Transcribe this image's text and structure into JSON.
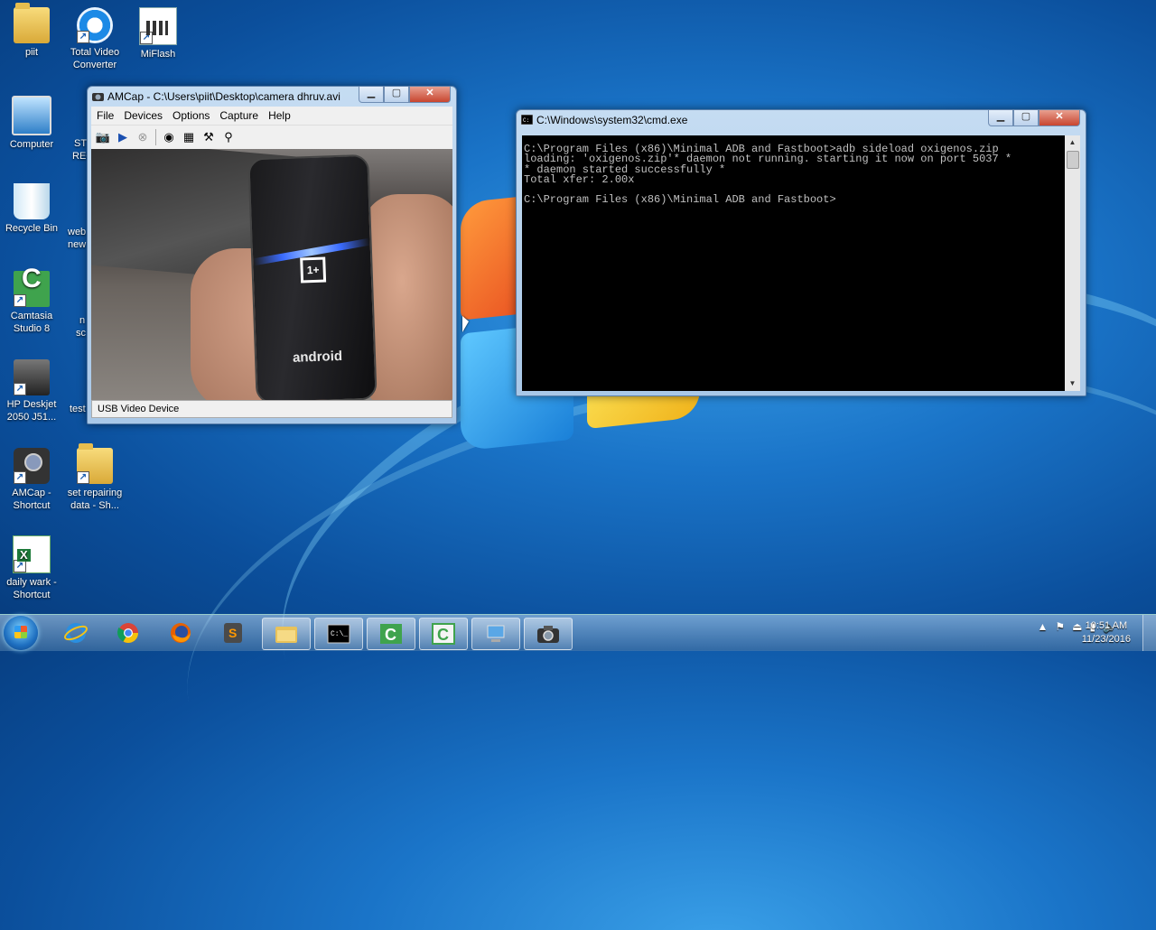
{
  "desktop": {
    "icons": [
      {
        "label": "piit"
      },
      {
        "label": "Total Video Converter"
      },
      {
        "label": "MiFlash"
      },
      {
        "label": "Computer"
      },
      {
        "label": "Recycle Bin"
      },
      {
        "label": "Camtasia Studio 8"
      },
      {
        "label": "HP Deskjet 2050 J51..."
      },
      {
        "label": "AMCap - Shortcut"
      },
      {
        "label": "set repairing data - Sh..."
      },
      {
        "label": "daily wark - Shortcut"
      }
    ],
    "partial_labels": [
      "ST",
      "REC",
      "web",
      "new",
      "n",
      "sc",
      "test"
    ]
  },
  "amcap": {
    "title": "AMCap - C:\\Users\\piit\\Desktop\\camera dhruv.avi",
    "menu": [
      "File",
      "Devices",
      "Options",
      "Capture",
      "Help"
    ],
    "status": "USB Video Device",
    "video_overlay": {
      "brand_logo": "1+",
      "boot_text": "android"
    }
  },
  "cmd": {
    "title": "C:\\Windows\\system32\\cmd.exe",
    "lines": [
      "C:\\Program Files (x86)\\Minimal ADB and Fastboot>adb sideload oxigenos.zip",
      "loading: 'oxigenos.zip'* daemon not running. starting it now on port 5037 *",
      "* daemon started successfully *",
      "Total xfer: 2.00x",
      "",
      "C:\\Program Files (x86)\\Minimal ADB and Fastboot>"
    ]
  },
  "taskbar": {
    "pinned": [
      {
        "name": "internet-explorer"
      },
      {
        "name": "chrome"
      },
      {
        "name": "firefox"
      },
      {
        "name": "sublime"
      },
      {
        "name": "explorer"
      },
      {
        "name": "cmd"
      },
      {
        "name": "camtasia-recorder"
      },
      {
        "name": "camtasia-studio"
      },
      {
        "name": "network-app"
      },
      {
        "name": "amcap"
      }
    ],
    "clock": {
      "time": "10:51 AM",
      "date": "11/23/2016"
    }
  },
  "colors": {
    "desktop": "#1a74c8",
    "console_bg": "#000000",
    "console_fg": "#c0c0c0"
  }
}
